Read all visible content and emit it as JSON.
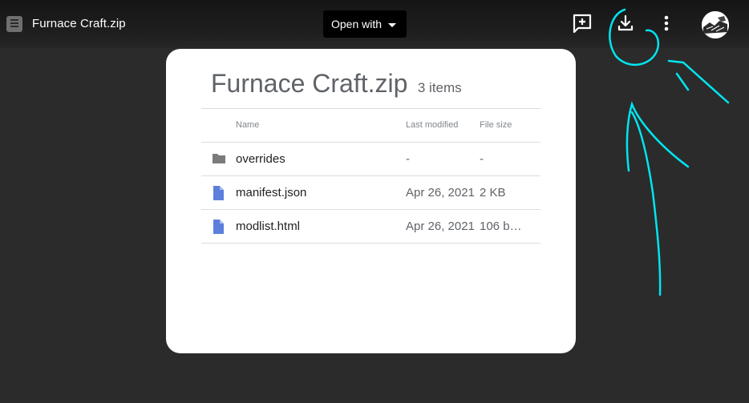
{
  "header": {
    "title": "Furnace Craft.zip",
    "open_with_label": "Open with",
    "icons": [
      "zip-file-icon",
      "add-comment-icon",
      "download-icon",
      "more-vert-icon",
      "avatar"
    ]
  },
  "card": {
    "title": "Furnace Craft.zip",
    "item_count": "3 items",
    "columns": {
      "name": "Name",
      "last_modified": "Last modified",
      "file_size": "File size"
    },
    "rows": [
      {
        "icon": "folder-icon",
        "name": "overrides",
        "modified": "-",
        "size": "-"
      },
      {
        "icon": "document-icon",
        "name": "manifest.json",
        "modified": "Apr 26, 2021",
        "size": "2 KB"
      },
      {
        "icon": "document-icon",
        "name": "modlist.html",
        "modified": "Apr 26, 2021",
        "size": "106 b…"
      }
    ]
  },
  "colors": {
    "background": "#2b2b2b",
    "annotation": "#00e5f0",
    "doc_icon": "#5b7fdb",
    "folder_icon": "#7b7b7b"
  }
}
